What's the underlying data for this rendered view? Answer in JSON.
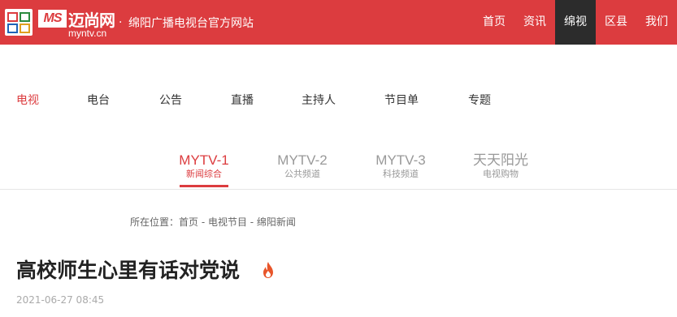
{
  "brand": {
    "short_logo": "MS",
    "name": "迈尚网",
    "domain": "myntv.cn",
    "separator": "·",
    "site_title": "绵阳广播电视台官方网站"
  },
  "top_nav": [
    {
      "label": "首页",
      "active": false
    },
    {
      "label": "资讯",
      "active": false
    },
    {
      "label": "绵视",
      "active": true
    },
    {
      "label": "区县",
      "active": false
    },
    {
      "label": "我们",
      "active": false
    }
  ],
  "sub_nav": [
    {
      "label": "电视",
      "active": true
    },
    {
      "label": "电台",
      "active": false
    },
    {
      "label": "公告",
      "active": false
    },
    {
      "label": "直播",
      "active": false
    },
    {
      "label": "主持人",
      "active": false
    },
    {
      "label": "节目单",
      "active": false
    },
    {
      "label": "专题",
      "active": false
    }
  ],
  "channels": [
    {
      "name": "MYTV-1",
      "desc": "新闻综合",
      "active": true
    },
    {
      "name": "MYTV-2",
      "desc": "公共频道",
      "active": false
    },
    {
      "name": "MYTV-3",
      "desc": "科技频道",
      "active": false
    },
    {
      "name": "天天阳光",
      "desc": "电视购物",
      "active": false
    }
  ],
  "breadcrumb": "所在位置：首页 - 电视节目 - 绵阳新闻",
  "article": {
    "title": "高校师生心里有话对党说",
    "hot_icon": "fire-icon",
    "date": "2021-06-27 08:45"
  },
  "colors": {
    "brand_red": "#dc3c3f",
    "active_dark": "#2c2c2c"
  }
}
